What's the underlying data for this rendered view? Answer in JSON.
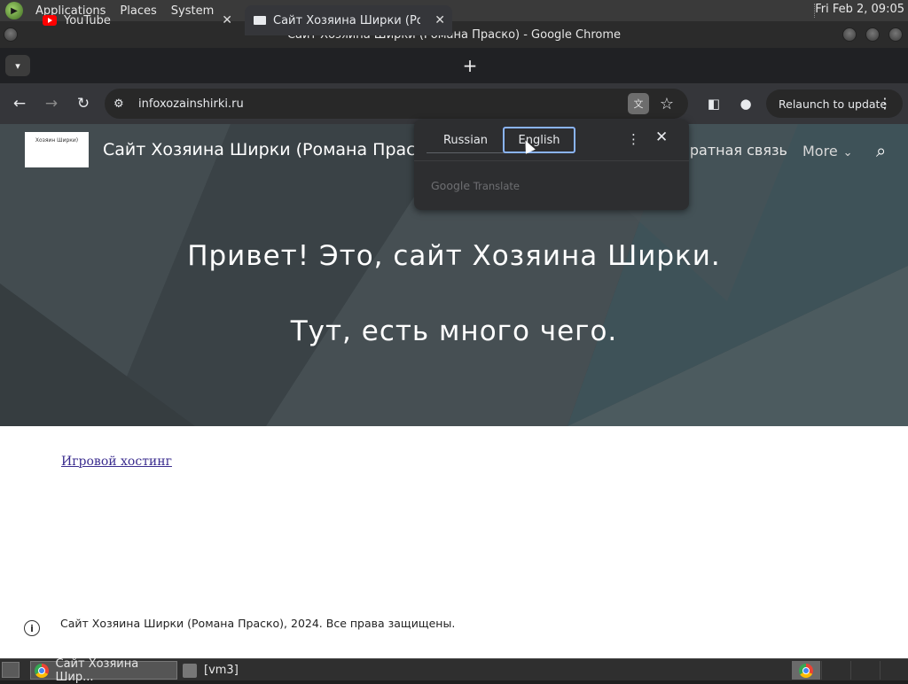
{
  "top_panel": {
    "menus": [
      "Applications",
      "Places",
      "System"
    ],
    "clock": "Fri Feb  2, 09:05"
  },
  "window": {
    "title": "Сайт Хозяина Ширки (Романа Праско) - Google Chrome"
  },
  "tabs": [
    {
      "title": "YouTube",
      "active": false
    },
    {
      "title": "Сайт Хозяина Ширки (Романа Праско)",
      "active": true
    }
  ],
  "toolbar": {
    "url": "infoxozainshirki.ru",
    "relaunch_label": "Relaunch to update"
  },
  "site": {
    "logo_text": "Хозяин Ширки)",
    "title": "Сайт Хозяина Ширки (Романа Праско)",
    "nav_feedback": "братная связь",
    "nav_more": "More",
    "hero_line_1": "Привет! Это, сайт Хозяина Ширки.",
    "hero_line_2": "Тут, есть много чего.",
    "hosting_link": "Игровой хостинг",
    "footer": "Сайт Хозяина Ширки (Романа Праско), 2024. Все права защищены."
  },
  "translate_popup": {
    "languages": [
      "Russian",
      "English"
    ],
    "selected": "English",
    "brand_google": "Google",
    "brand_translate": "Translate"
  },
  "taskbar": {
    "tasks": [
      "Сайт Хозяина Шир...",
      "[vm3]"
    ]
  },
  "colors": {
    "hero_bg": "#3d4549",
    "popup_bg": "#2d2e30",
    "focus_ring": "#8ab4f8",
    "link": "#3b2d8f"
  }
}
